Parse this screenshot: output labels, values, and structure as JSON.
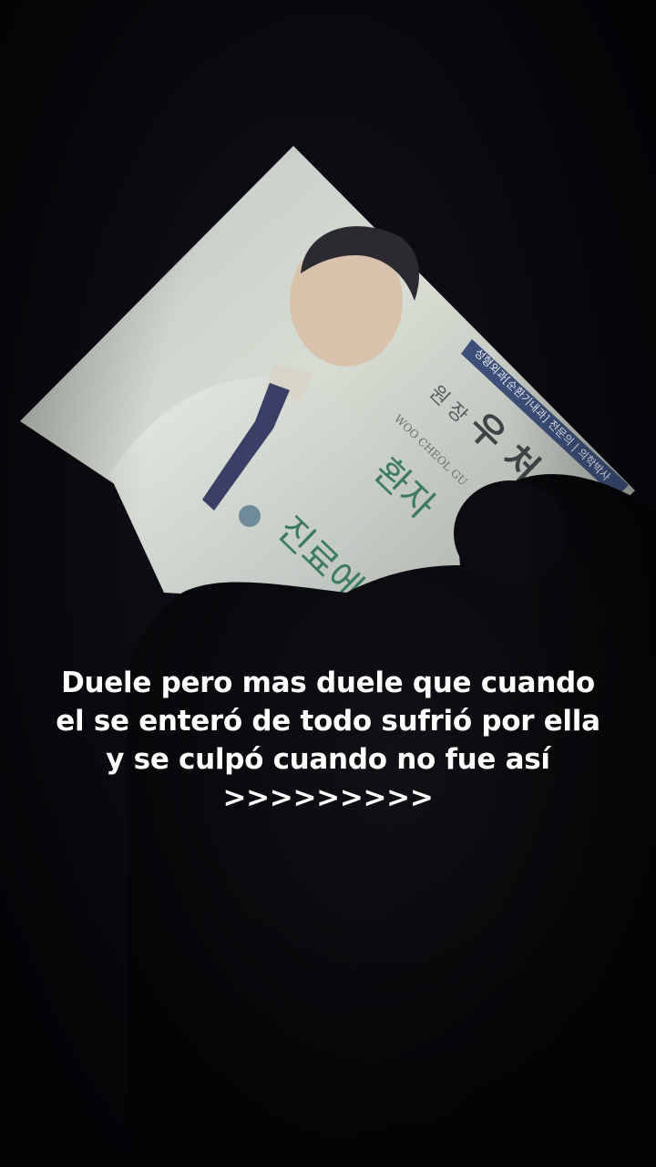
{
  "image": {
    "subject": "photo-of-poster",
    "poster_text": {
      "title_korean": "원 장",
      "name_korean": "우 처 구",
      "romanized": "WOO CHEOL GU",
      "top_banner": "성형외과[순환기내과] 전문의 | 의학박사",
      "line_1": "환자",
      "line_2": "진료에 최"
    }
  },
  "caption": {
    "line1": "Duele pero mas duele que cuando",
    "line2": "el se enteró de todo sufrió por ella",
    "line3": "y se culpó cuando no fue así",
    "line4": ">>>>>>>>>"
  }
}
